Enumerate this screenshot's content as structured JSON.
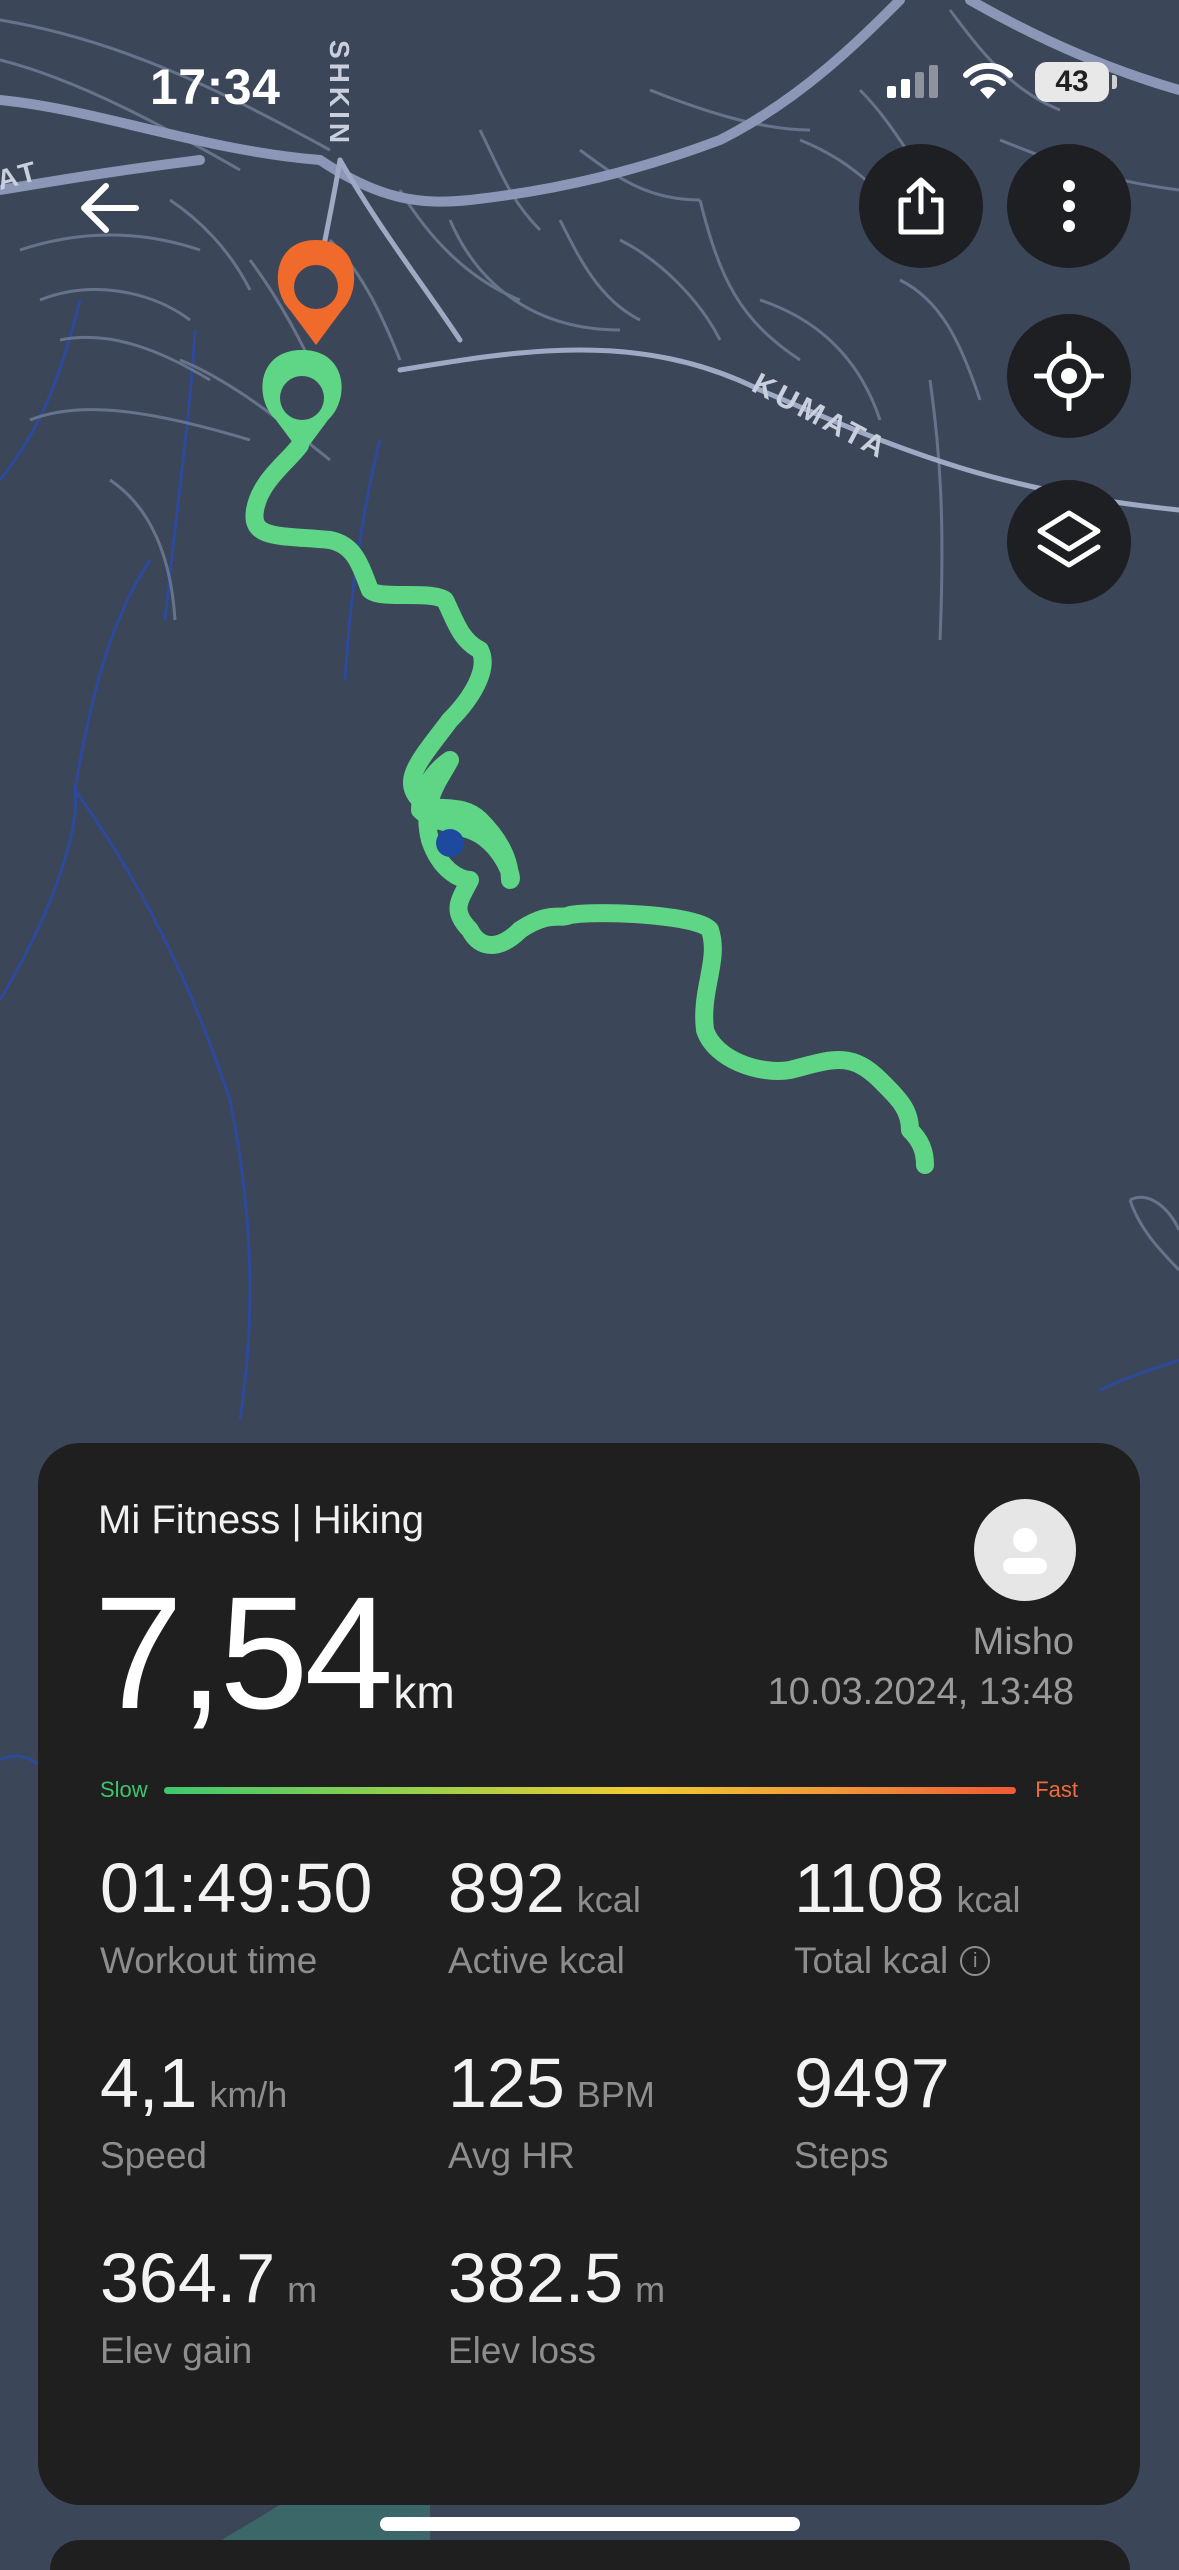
{
  "status_bar": {
    "time": "17:34",
    "battery": "43"
  },
  "map": {
    "street_labels": [
      "SHKIN",
      "AT",
      "KUMATA"
    ],
    "route_color": "#5fd686",
    "start_marker_color": "#5fd686",
    "end_marker_color": "#f06a2b"
  },
  "icons": {
    "back": "arrow-left-icon",
    "share": "share-icon",
    "more": "more-vertical-icon",
    "locate": "locate-icon",
    "layers": "layers-icon"
  },
  "workout": {
    "title": "Mi Fitness | Hiking",
    "distance": "7,54",
    "distance_unit": "km",
    "user": "Misho",
    "datetime": "10.03.2024, 13:48",
    "pace_slow": "Slow",
    "pace_fast": "Fast",
    "stats": [
      {
        "value": "01:49:50",
        "unit": "",
        "label": "Workout time"
      },
      {
        "value": "892",
        "unit": "kcal",
        "label": "Active kcal"
      },
      {
        "value": "1108",
        "unit": "kcal",
        "label": "Total kcal"
      },
      {
        "value": "4,1",
        "unit": "km/h",
        "label": "Speed"
      },
      {
        "value": "125",
        "unit": "BPM",
        "label": "Avg HR"
      },
      {
        "value": "9497",
        "unit": "",
        "label": "Steps"
      },
      {
        "value": "364.7",
        "unit": "m",
        "label": "Elev gain"
      },
      {
        "value": "382.5",
        "unit": "m",
        "label": "Elev loss"
      }
    ],
    "total_info": "i"
  }
}
